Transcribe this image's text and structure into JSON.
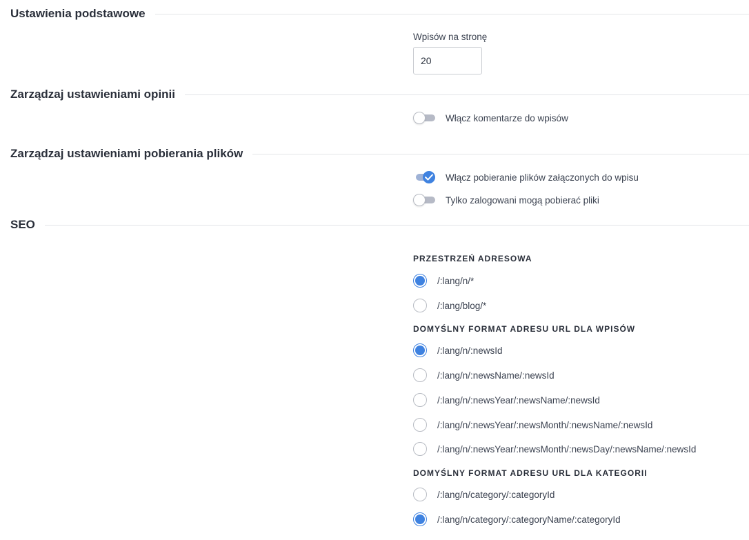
{
  "sections": {
    "basic": {
      "title": "Ustawienia podstawowe"
    },
    "comments": {
      "title": "Zarządzaj ustawieniami opinii"
    },
    "downloads": {
      "title": "Zarządzaj ustawieniami pobierania plików"
    },
    "seo": {
      "title": "SEO"
    }
  },
  "posts_per_page": {
    "label": "Wpisów na stronę",
    "value": "20"
  },
  "toggles": {
    "enable_comments": {
      "label": "Włącz komentarze do wpisów",
      "checked": false
    },
    "enable_downloads": {
      "label": "Włącz pobieranie plików załączonych do wpisu",
      "checked": true
    },
    "logged_only": {
      "label": "Tylko zalogowani mogą pobierać pliki",
      "checked": false
    }
  },
  "seo": {
    "namespace": {
      "title": "PRZESTRZEŃ ADRESOWA",
      "options": [
        {
          "label": "/:lang/n/*",
          "checked": true
        },
        {
          "label": "/:lang/blog/*",
          "checked": false
        }
      ]
    },
    "post_url": {
      "title": "DOMYŚLNY FORMAT ADRESU URL DLA WPISÓW",
      "options": [
        {
          "label": "/:lang/n/:newsId",
          "checked": true
        },
        {
          "label": "/:lang/n/:newsName/:newsId",
          "checked": false
        },
        {
          "label": "/:lang/n/:newsYear/:newsName/:newsId",
          "checked": false
        },
        {
          "label": "/:lang/n/:newsYear/:newsMonth/:newsName/:newsId",
          "checked": false
        },
        {
          "label": "/:lang/n/:newsYear/:newsMonth/:newsDay/:newsName/:newsId",
          "checked": false
        }
      ]
    },
    "category_url": {
      "title": "DOMYŚLNY FORMAT ADRESU URL DLA KATEGORII",
      "options": [
        {
          "label": "/:lang/n/category/:categoryId",
          "checked": false
        },
        {
          "label": "/:lang/n/category/:categoryName/:categoryId",
          "checked": true
        }
      ]
    }
  },
  "colors": {
    "accent": "#3f82e0",
    "divider": "#e3e5e8",
    "heading": "#2a2f3a"
  }
}
